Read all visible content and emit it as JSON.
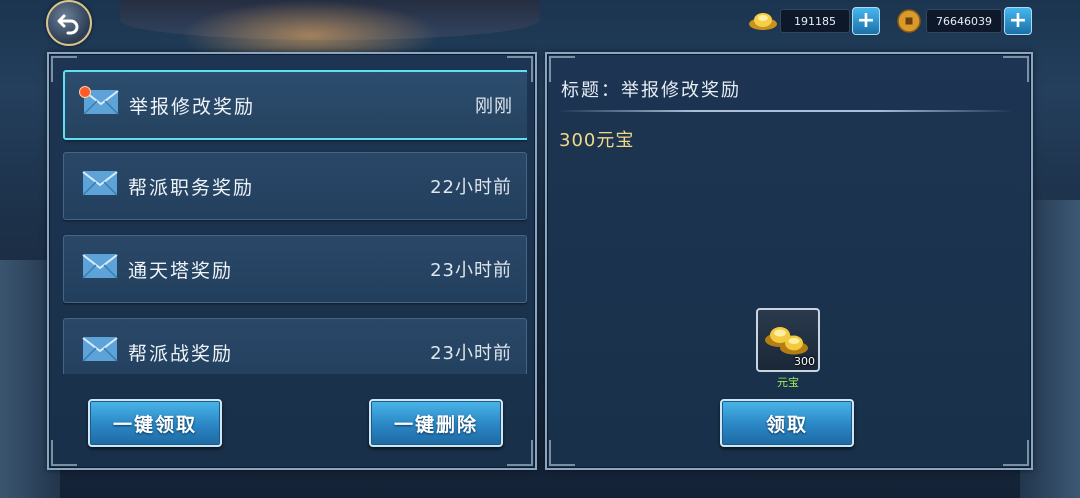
{
  "currency": {
    "ingot_amount": "191185",
    "coin_amount": "76646039",
    "ingot_icon": "gold-ingot-icon",
    "coin_icon": "copper-coin-icon"
  },
  "mail": {
    "items": [
      {
        "title": "举报修改奖励",
        "time": "刚刚",
        "unread": true,
        "selected": true
      },
      {
        "title": "帮派职务奖励",
        "time": "22小时前",
        "unread": false,
        "selected": false
      },
      {
        "title": "通天塔奖励",
        "time": "23小时前",
        "unread": false,
        "selected": false
      },
      {
        "title": "帮派战奖励",
        "time": "23小时前",
        "unread": false,
        "selected": false
      }
    ],
    "claim_all_label": "一键领取",
    "delete_all_label": "一键删除"
  },
  "detail": {
    "title": "标题：举报修改奖励",
    "body": "300元宝",
    "reward": {
      "count": "300",
      "name": "元宝",
      "icon": "gold-ingot-icon"
    },
    "claim_label": "领取"
  },
  "colors": {
    "accent_selected": "#5fe0f2",
    "button_blue": "#2a86c4",
    "reward_text": "#f1d98a",
    "item_name": "#9cf05a",
    "unread_dot": "#ff5a2e"
  }
}
